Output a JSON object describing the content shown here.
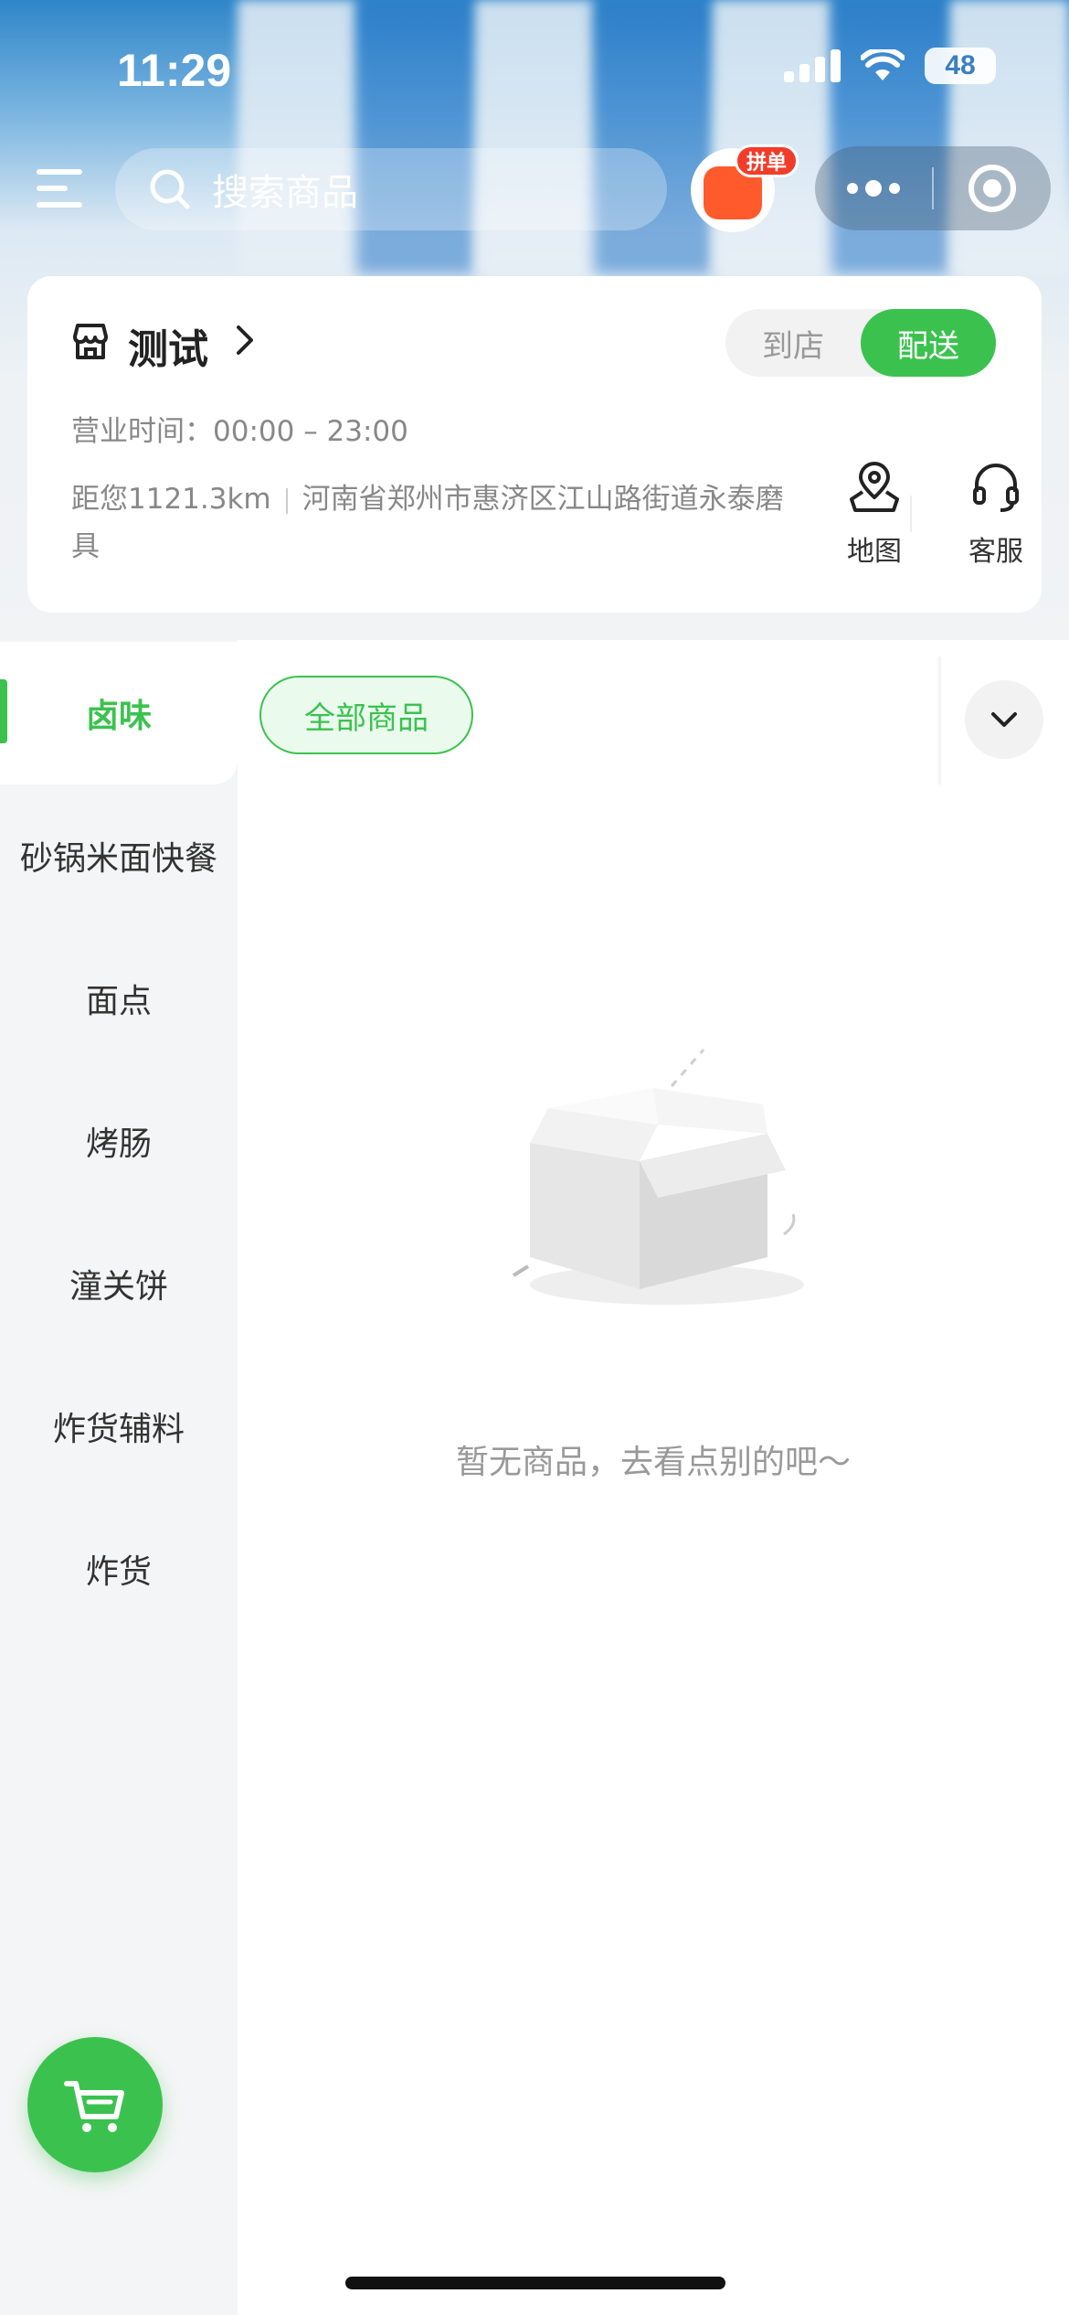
{
  "status_bar": {
    "time": "11:29",
    "battery": "48"
  },
  "search": {
    "placeholder": "搜索商品"
  },
  "promo": {
    "badge": "拼单"
  },
  "store": {
    "name": "测试",
    "modes": [
      "到店",
      "配送"
    ],
    "active_mode": "配送",
    "hours_label": "营业时间：00:00 – 23:00",
    "distance": "距您1121.3km",
    "address": "河南省郑州市惠济区江山路街道永泰磨具",
    "actions": {
      "map": "地图",
      "service": "客服"
    }
  },
  "categories": {
    "items": [
      "卤味",
      "砂锅米面快餐",
      "面点",
      "烤肠",
      "潼关饼",
      "炸货辅料",
      "炸货"
    ],
    "active": "卤味"
  },
  "filter_chip": "全部商品",
  "empty_state": {
    "text": "暂无商品，去看点别的吧～"
  },
  "colors": {
    "accent": "#3bc24e",
    "badge": "#f23c2a"
  },
  "icons": [
    "menu-icon",
    "search-icon",
    "promo-bag-icon",
    "more-icon",
    "close-ring-icon",
    "store-icon",
    "chevron-right-icon",
    "map-pin-icon",
    "headset-icon",
    "chevron-down-icon",
    "empty-box-icon",
    "cart-icon"
  ]
}
